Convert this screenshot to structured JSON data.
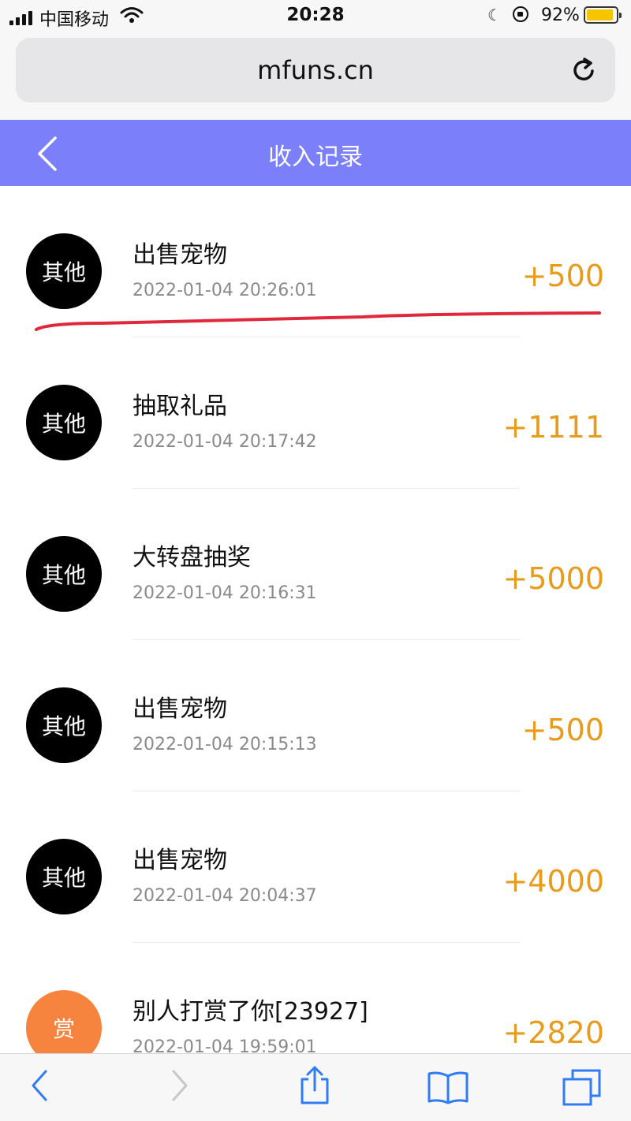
{
  "status_bar": {
    "carrier": "中国移动",
    "time": "20:28",
    "battery_percent": "92%",
    "battery_level": 0.92,
    "icons": [
      "signal-icon",
      "wifi-icon",
      "moon-icon",
      "orientation-lock-icon",
      "battery-icon"
    ]
  },
  "browser": {
    "url": "mfuns.cn",
    "reload_icon": "reload-icon"
  },
  "header": {
    "title": "收入记录",
    "back_icon": "chevron-left-icon"
  },
  "records": [
    {
      "badge": "其他",
      "title": "出售宠物",
      "time": "2022-01-04 20:26:01",
      "amount": "+500",
      "badge_color": "#000000"
    },
    {
      "badge": "其他",
      "title": "抽取礼品",
      "time": "2022-01-04 20:17:42",
      "amount": "+1111",
      "badge_color": "#000000"
    },
    {
      "badge": "其他",
      "title": "大转盘抽奖",
      "time": "2022-01-04 20:16:31",
      "amount": "+5000",
      "badge_color": "#000000"
    },
    {
      "badge": "其他",
      "title": "出售宠物",
      "time": "2022-01-04 20:15:13",
      "amount": "+500",
      "badge_color": "#000000"
    },
    {
      "badge": "其他",
      "title": "出售宠物",
      "time": "2022-01-04 20:04:37",
      "amount": "+4000",
      "badge_color": "#000000"
    },
    {
      "badge": "赏",
      "title": "别人打赏了你[23927]",
      "time": "2022-01-04 19:59:01",
      "amount": "+2820",
      "badge_color": "#f7843e"
    }
  ],
  "toolbar": {
    "icons": [
      "back-icon",
      "forward-icon",
      "share-icon",
      "bookmarks-icon",
      "tabs-icon"
    ]
  },
  "colors": {
    "header_bg": "#7b7ff9",
    "amount": "#e89b1c",
    "annotation_stroke": "#e0283c"
  }
}
